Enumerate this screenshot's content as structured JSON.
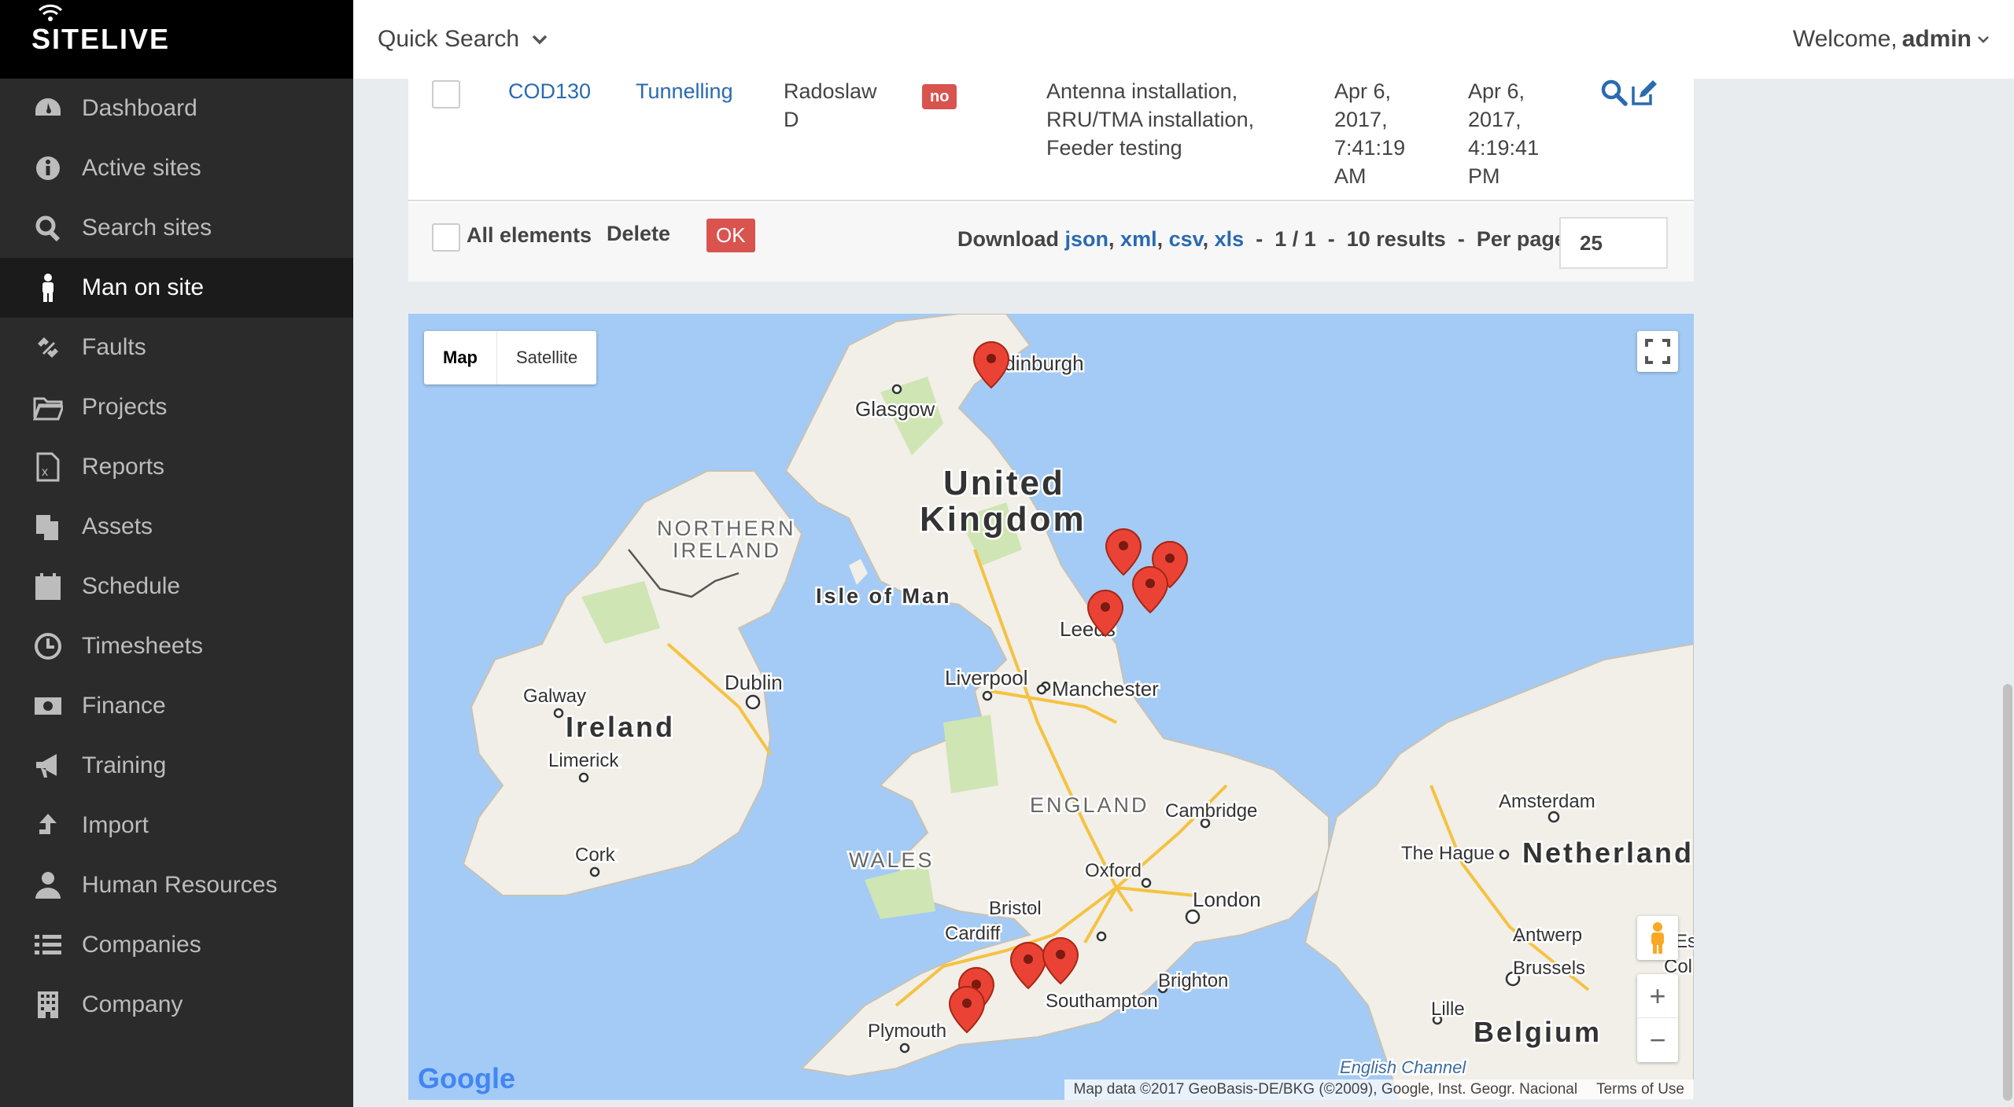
{
  "app": {
    "name": "SITELIVE"
  },
  "sidebar": {
    "items": [
      {
        "label": "Dashboard",
        "icon": "dashboard-icon"
      },
      {
        "label": "Active sites",
        "icon": "info-icon"
      },
      {
        "label": "Search sites",
        "icon": "search-icon"
      },
      {
        "label": "Man on site",
        "icon": "person-icon"
      },
      {
        "label": "Faults",
        "icon": "broken-link-icon"
      },
      {
        "label": "Projects",
        "icon": "folder-icon"
      },
      {
        "label": "Reports",
        "icon": "excel-file-icon"
      },
      {
        "label": "Assets",
        "icon": "copy-icon"
      },
      {
        "label": "Schedule",
        "icon": "calendar-icon"
      },
      {
        "label": "Timesheets",
        "icon": "clock-icon"
      },
      {
        "label": "Finance",
        "icon": "money-icon"
      },
      {
        "label": "Training",
        "icon": "megaphone-icon"
      },
      {
        "label": "Import",
        "icon": "upload-arrow-icon"
      },
      {
        "label": "Human Resources",
        "icon": "user-icon"
      },
      {
        "label": "Companies",
        "icon": "list-icon"
      },
      {
        "label": "Company",
        "icon": "building-icon"
      }
    ],
    "active_index": 3
  },
  "topbar": {
    "quick_search": "Quick Search",
    "welcome_prefix": "Welcome,",
    "user": "admin"
  },
  "table": {
    "row": {
      "code": "COD130",
      "project": "Tunnelling",
      "person_line1": "Radoslaw",
      "person_line2": "D",
      "badge": "no",
      "activities_line1": "Antenna installation,",
      "activities_line2": "RRU/TMA installation,",
      "activities_line3": "Feeder testing",
      "start_line1": "Apr 6,",
      "start_line2": "2017,",
      "start_line3": "7:41:19",
      "start_line4": "AM",
      "end_line1": "Apr 6,",
      "end_line2": "2017,",
      "end_line3": "4:19:41",
      "end_line4": "PM"
    },
    "footer": {
      "all_elements": "All elements",
      "delete": "Delete",
      "ok": "OK",
      "download": "Download",
      "formats": [
        "json",
        "xml",
        "csv",
        "xls"
      ],
      "page": "1 / 1",
      "results": "10 results",
      "per_page_label": "Per page",
      "per_page_value": "25"
    }
  },
  "map": {
    "type_map": "Map",
    "type_satellite": "Satellite",
    "zoom_in": "+",
    "zoom_out": "−",
    "google": "Google",
    "attribution": "Map data ©2017 GeoBasis-DE/BKG (©2009), Google, Inst. Geogr. Nacional",
    "terms": "Terms of Use",
    "labels": {
      "uk1": "United",
      "uk2": "Kingdom",
      "ni1": "NORTHERN",
      "ni2": "IRELAND",
      "iom": "Isle of Man",
      "ireland": "Ireland",
      "england": "ENGLAND",
      "wales": "WALES",
      "netherlands": "Netherland",
      "belgium": "Belgium",
      "channel": "English Channel",
      "edinburgh": "Edinburgh",
      "glasgow": "Glasgow",
      "leeds": "Leeds",
      "liverpool": "Liverpool",
      "manchester": "Manchester",
      "dublin": "Dublin",
      "galway": "Galway",
      "limerick": "Limerick",
      "cork": "Cork",
      "cambridge": "Cambridge",
      "oxford": "Oxford",
      "london": "London",
      "bristol": "Bristol",
      "cardiff": "Cardiff",
      "southampton": "Southampton",
      "brighton": "Brighton",
      "plymouth": "Plymouth",
      "amsterdam": "Amsterdam",
      "thehague": "The Hague",
      "antwerp": "Antwerp",
      "brussels": "Brussels",
      "lille": "Lille",
      "es": "Es",
      "col": "Col"
    }
  }
}
